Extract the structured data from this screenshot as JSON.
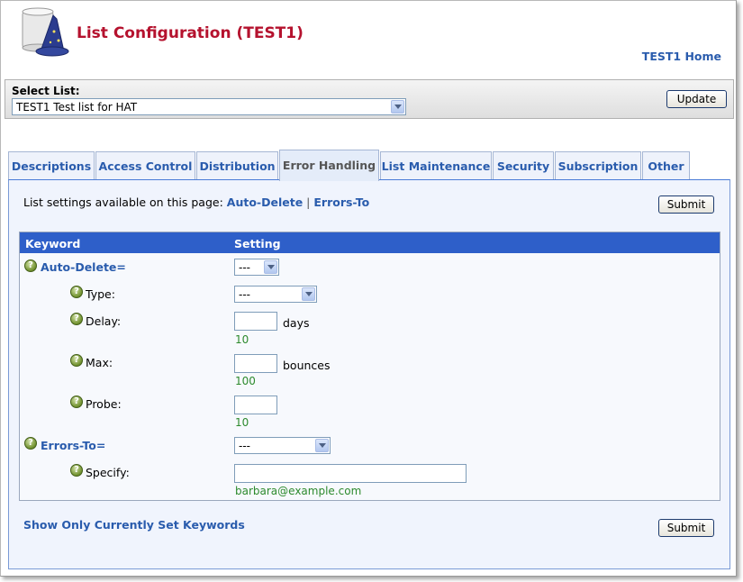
{
  "header": {
    "title": "List Configuration (TEST1)",
    "home_link": "TEST1 Home"
  },
  "select_list": {
    "label": "Select List:",
    "value": "TEST1 Test list for HAT",
    "update_label": "Update"
  },
  "tabs": [
    {
      "label": "Descriptions",
      "active": false
    },
    {
      "label": "Access Control",
      "active": false
    },
    {
      "label": "Distribution",
      "active": false
    },
    {
      "label": "Error Handling",
      "active": true
    },
    {
      "label": "List Maintenance",
      "active": false
    },
    {
      "label": "Security",
      "active": false
    },
    {
      "label": "Subscription",
      "active": false
    },
    {
      "label": "Other",
      "active": false
    }
  ],
  "panel": {
    "available_prefix": "List settings available on this page:",
    "available_links": [
      "Auto-Delete",
      "Errors-To"
    ],
    "separator": "|",
    "submit_label": "Submit",
    "show_only_link": "Show Only Currently Set Keywords"
  },
  "table": {
    "col_keyword": "Keyword",
    "col_setting": "Setting"
  },
  "settings": {
    "auto_delete": {
      "label": "Auto-Delete=",
      "value": "---"
    },
    "type": {
      "label": "Type:",
      "value": "---"
    },
    "delay": {
      "label": "Delay:",
      "value": "",
      "unit": "days",
      "default": "10"
    },
    "max": {
      "label": "Max:",
      "value": "",
      "unit": "bounces",
      "default": "100"
    },
    "probe": {
      "label": "Probe:",
      "value": "",
      "default": "10"
    },
    "errors_to": {
      "label": "Errors-To=",
      "value": "---"
    },
    "specify": {
      "label": "Specify:",
      "value": "",
      "default": "barbara@example.com"
    }
  },
  "icons": {
    "logo": "wizard-hat-scroll-icon",
    "help": "help-icon",
    "dropdown": "chevron-down-icon"
  },
  "colors": {
    "title": "#b5122e",
    "link": "#2a5cad",
    "header_bar": "#2e5fc9",
    "default_value": "#2d8a2d",
    "help_icon": "#6f8f2c"
  }
}
